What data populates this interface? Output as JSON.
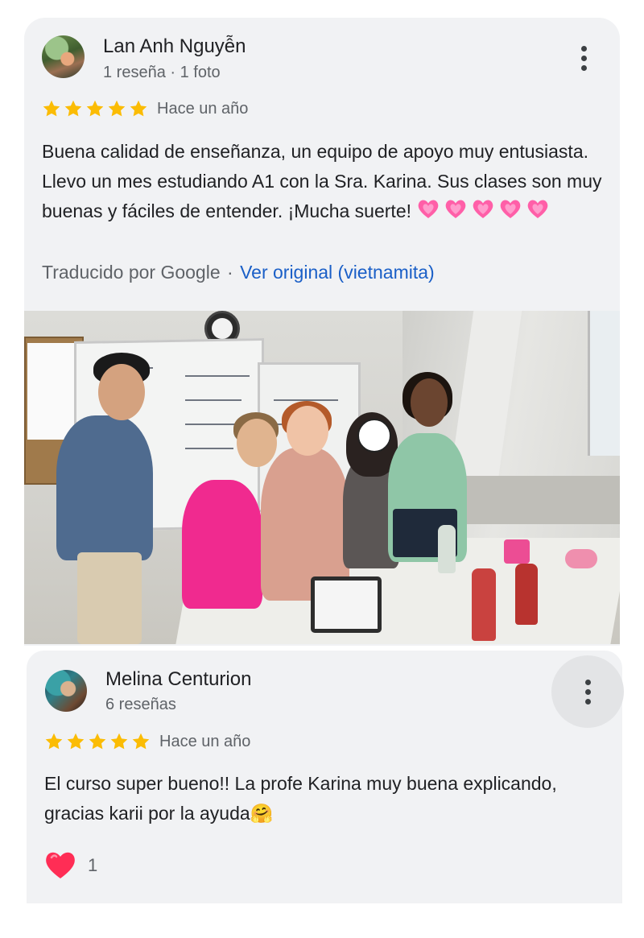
{
  "colors": {
    "star": "#fbbc04",
    "link": "#1a5fc7",
    "card_bg": "#f1f2f4",
    "heart": "#ff2d55"
  },
  "reviews": [
    {
      "author": "Lan Anh Nguyễn",
      "meta": "1 reseña · 1 foto",
      "rating": 5,
      "when": "Hace un año",
      "text": "Buena calidad de enseñanza, un equipo de apoyo muy entusiasta. Llevo un mes estudiando A1 con la Sra. Karina. Sus clases son muy buenas y fáciles de entender. ¡Mucha suerte!",
      "emoji": "💗💗💗💗💗",
      "translated_by": "Traducido por Google",
      "separator": "·",
      "view_original": "Ver original (vietnamita)",
      "menu_icon": "more-vert-icon",
      "photo": "classroom-group-photo"
    },
    {
      "author": "Melina Centurion",
      "meta": "6 reseñas",
      "rating": 5,
      "when": "Hace un año",
      "text": "El curso super bueno!! La profe Karina muy buena explicando, gracias karii por la ayuda🤗",
      "menu_icon": "more-vert-icon",
      "reaction_icon": "heart-icon",
      "reaction_count": "1"
    }
  ]
}
